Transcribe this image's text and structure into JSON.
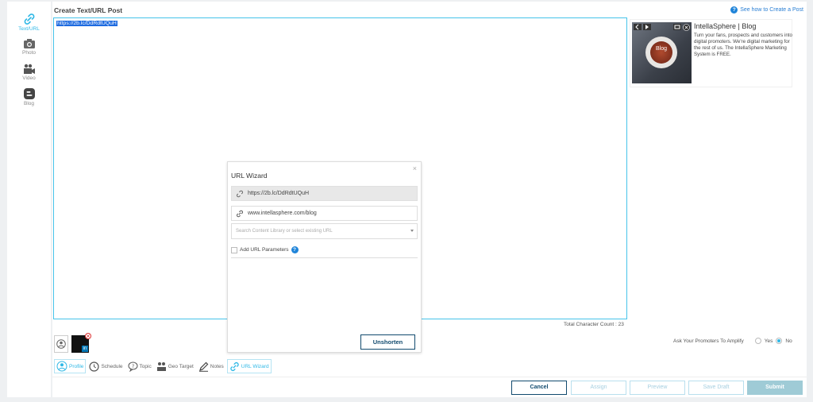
{
  "nav": {
    "items": [
      {
        "label": "Text/URL",
        "icon": "link-icon",
        "active": true
      },
      {
        "label": "Photo",
        "icon": "camera-icon"
      },
      {
        "label": "Video",
        "icon": "video-icon"
      },
      {
        "label": "Blog",
        "icon": "blogger-icon"
      }
    ]
  },
  "header": {
    "title": "Create Text/URL Post",
    "help_link": "See how to Create a Post"
  },
  "editor": {
    "text": "https://2b.lc/DdRdtUQuH"
  },
  "link_preview": {
    "title": "IntellaSphere | Blog",
    "description": "Turn your fans, prospects and customers into digital promoters. We're digital marketing for the rest of us. The IntellaSphere Marketing System is FREE.",
    "image_label": "Blog"
  },
  "counter": {
    "label": "Total Character Count : 23"
  },
  "amplify": {
    "question": "Ask Your Promoters To Amplify",
    "yes": "Yes",
    "no": "No",
    "selected": "No"
  },
  "avatars": {
    "badge": "in"
  },
  "tabs": [
    {
      "label": "Profile",
      "icon": "profile-icon",
      "active": true
    },
    {
      "label": "Schedule",
      "icon": "clock-icon"
    },
    {
      "label": "Topic",
      "icon": "topic-icon"
    },
    {
      "label": "Geo Target",
      "icon": "geo-target-icon"
    },
    {
      "label": "Notes",
      "icon": "pencil-icon"
    },
    {
      "label": "URL Wizard",
      "icon": "link-icon",
      "active": true
    }
  ],
  "actions": {
    "cancel": "Cancel",
    "assign": "Assign",
    "preview": "Preview",
    "save_draft": "Save Draft",
    "submit": "Submit"
  },
  "wizard": {
    "title": "URL Wizard",
    "short_url": "https://2b.lc/DdRdtUQuH",
    "long_url": "www.intellasphere.com/blog",
    "search_placeholder": "Search Content Library or select existing URL",
    "add_params_label": "Add URL Parameters",
    "unshorten": "Unshorten",
    "close": "×"
  },
  "colors": {
    "accent": "#2eb8e6",
    "primary_dark": "#114a6e",
    "help_blue": "#1f84d9"
  }
}
